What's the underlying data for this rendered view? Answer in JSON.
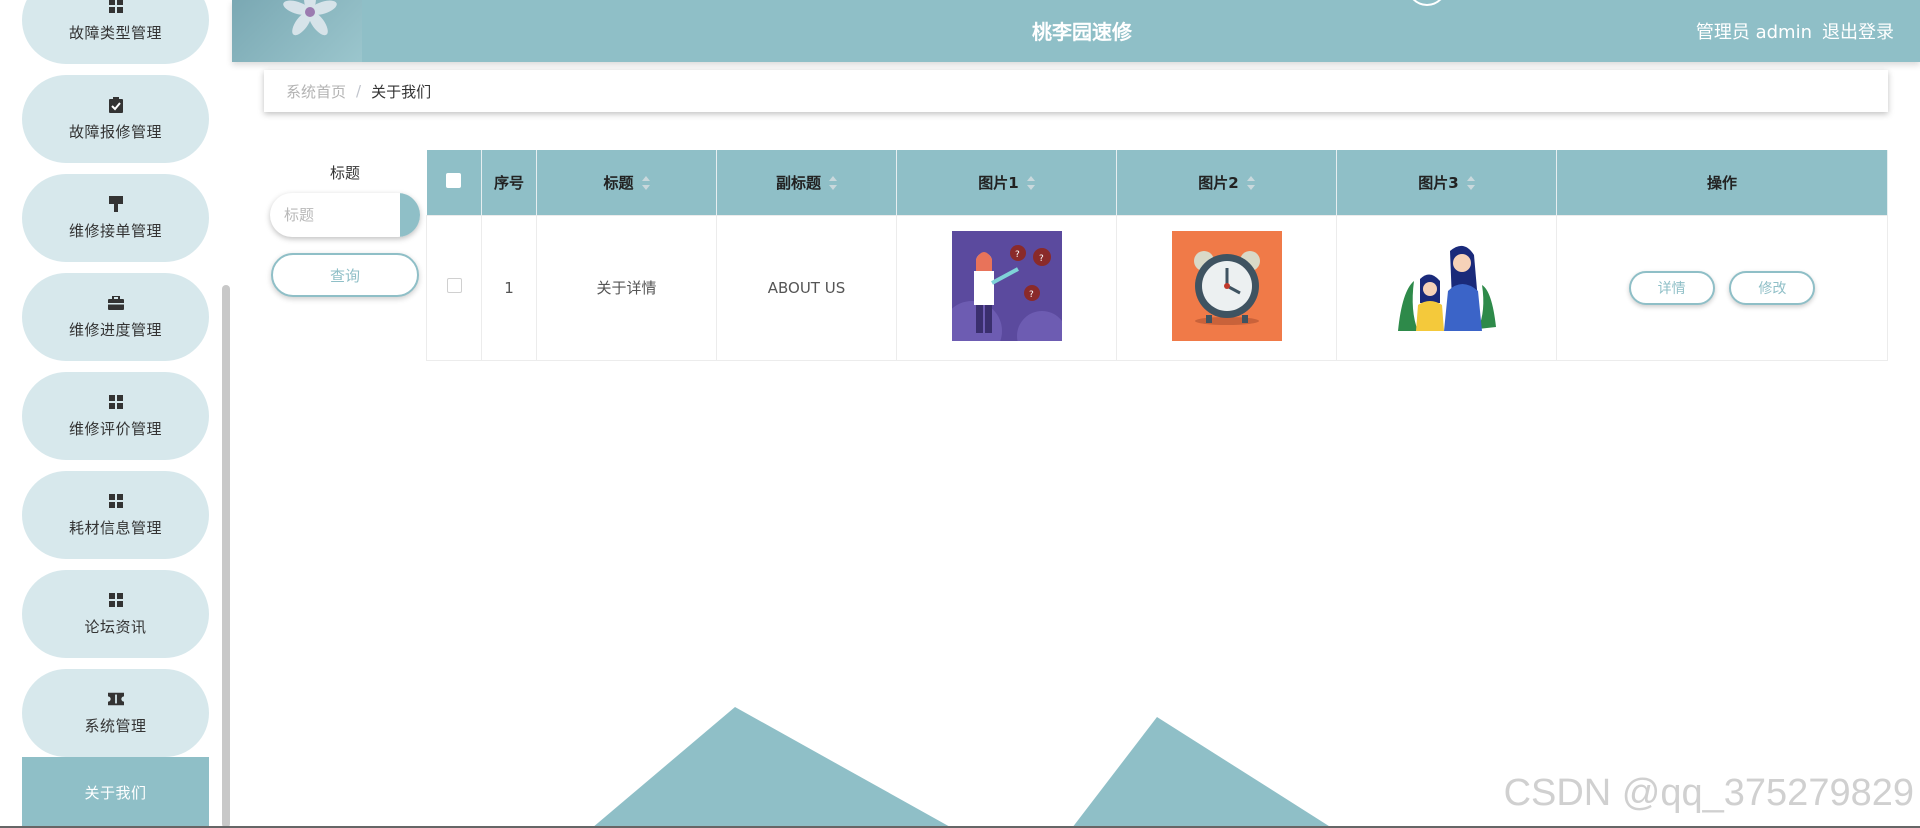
{
  "sidebar": {
    "items": [
      {
        "label": "故障类型管理",
        "icon": "grid-icon"
      },
      {
        "label": "故障报修管理",
        "icon": "clipboard-icon"
      },
      {
        "label": "维修接单管理",
        "icon": "brush-icon"
      },
      {
        "label": "维修进度管理",
        "icon": "briefcase-icon"
      },
      {
        "label": "维修评价管理",
        "icon": "grid-icon"
      },
      {
        "label": "耗材信息管理",
        "icon": "grid-icon"
      },
      {
        "label": "论坛资讯",
        "icon": "grid-icon"
      },
      {
        "label": "系统管理",
        "icon": "ticket-icon"
      }
    ],
    "active_item": "关于我们"
  },
  "header": {
    "title": "桃李园速修",
    "user_role": "管理员 admin",
    "logout": "退出登录"
  },
  "breadcrumb": {
    "home": "系统首页",
    "separator": "/",
    "current": "关于我们"
  },
  "search": {
    "label": "标题",
    "placeholder": "标题",
    "button": "查询"
  },
  "table": {
    "headers": {
      "index": "序号",
      "title": "标题",
      "subtitle": "副标题",
      "image1": "图片1",
      "image2": "图片2",
      "image3": "图片3",
      "actions": "操作"
    },
    "rows": [
      {
        "index": "1",
        "title": "关于详情",
        "subtitle": "ABOUT US",
        "detail": "详情",
        "edit": "修改"
      }
    ]
  },
  "watermark": "CSDN @qq_375279829",
  "colors": {
    "accent": "#8fbfc7",
    "menu_bg": "#d7e8ec",
    "image2_bg": "#f07a48",
    "image1_bg": "#5b4a9e"
  }
}
